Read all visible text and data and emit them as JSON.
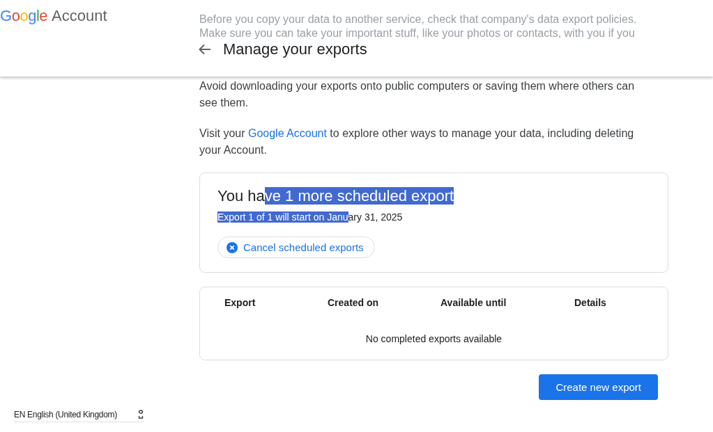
{
  "header": {
    "logo": "Google",
    "product": "Account",
    "faded_lines": [
      "Before you copy your data to another service, check that company's data export policies.",
      "Make sure you can take your important stuff, like your photos or contacts, with you if you"
    ],
    "title": "Manage your exports"
  },
  "paragraphs": [
    [
      {
        "text": "Avoid downloading your exports onto public computers or saving them where others can see them.",
        "kind": "text"
      }
    ],
    [
      {
        "text": "Visit your ",
        "kind": "text"
      },
      {
        "text": "Google Account",
        "kind": "link"
      },
      {
        "text": " to explore other ways to manage your data, including deleting your Account.",
        "kind": "text"
      }
    ]
  ],
  "scheduled": {
    "heading": [
      {
        "text": "You ha",
        "selected": false
      },
      {
        "text": "ve 1 more scheduled export ",
        "selected": true
      }
    ],
    "detail": [
      {
        "text": "Export 1 of 1 will start on Janu",
        "selected": true
      },
      {
        "text": "ary 31, 2025",
        "selected": false
      }
    ],
    "cancel_button": "Cancel scheduled exports"
  },
  "table": {
    "columns": [
      "Export",
      "Created on",
      "Available until",
      "Details"
    ],
    "empty_message": "No completed exports available"
  },
  "create_button": "Create new export",
  "footer": {
    "language": "EN English (United Kingdom)"
  }
}
